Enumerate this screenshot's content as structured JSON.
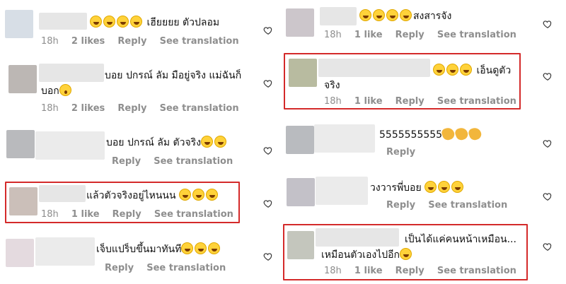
{
  "left_comments": [
    {
      "text": "เฮียยยย  ตัวปลอม",
      "emoji_before": "😂😂😂😂",
      "time": "18h",
      "likes": "2 likes",
      "reply": "Reply",
      "translate": "See translation"
    },
    {
      "text_line1": "บอย ปกรณ์ ลัม มือยู่จริง แม่ฉันก็",
      "text_line2": "บอก",
      "emoji_after": "😮",
      "time": "18h",
      "likes": "2 likes",
      "reply": "Reply",
      "translate": "See translation"
    },
    {
      "text": "บอย ปกรณ์ ลัม ตัวจริง",
      "emoji_after": "😂😂",
      "reply": "Reply",
      "translate": "See translation"
    },
    {
      "text": "แล้วตัวจริงอยู่ไหนนน ",
      "emoji_after": "😂😂😂",
      "time": "18h",
      "likes": "1 like",
      "reply": "Reply",
      "translate": "See translation"
    },
    {
      "text": "เจ็บแปร็บขึ้นมาทันที",
      "emoji_after": "😂😂😂",
      "reply": "Reply",
      "translate": "See translation"
    }
  ],
  "right_comments": [
    {
      "text": "สงสารจัง",
      "emoji_before": "😂😂😂😂",
      "time": "18h",
      "likes": "1 like",
      "reply": "Reply",
      "translate": "See translation"
    },
    {
      "text_line1": " เอ็นดูตัว",
      "emoji_before": "😂😂😂",
      "text_line2": "จริง",
      "time": "18h",
      "likes": "1 like",
      "reply": "Reply",
      "translate": "See translation"
    },
    {
      "text": "5555555555",
      "emoji_after": "👏👏👏",
      "reply": "Reply"
    },
    {
      "text": "วงวารพี่บอย ",
      "emoji_after": "😂😂😂",
      "reply": "Reply",
      "translate": "See translation"
    },
    {
      "text_line1": "เป็นได้แค่คนหน้าเหมือน...",
      "text_line2": "เหมือนตัวเองไปอีก",
      "emoji_after": "😂",
      "time": "18h",
      "likes": "1 like",
      "reply": "Reply",
      "translate": "See translation"
    }
  ]
}
